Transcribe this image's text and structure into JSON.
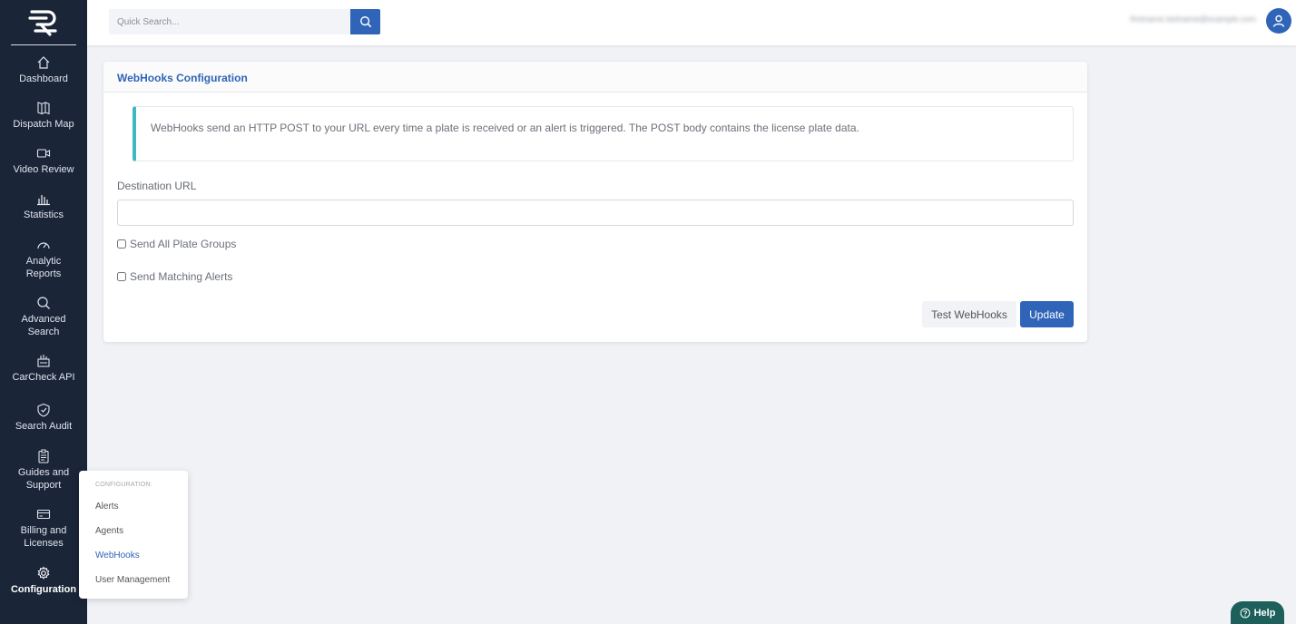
{
  "sidebar": {
    "items": [
      {
        "label": "Dashboard",
        "icon": "home-icon"
      },
      {
        "label": "Dispatch Map",
        "icon": "map-icon"
      },
      {
        "label": "Video Review",
        "icon": "video-icon"
      },
      {
        "label": "Statistics",
        "icon": "bar-chart-icon"
      },
      {
        "label": "Analytic\nReports",
        "icon": "gauge-icon"
      },
      {
        "label": "Advanced\nSearch",
        "icon": "search-icon"
      },
      {
        "label": "CarCheck API",
        "icon": "api-icon"
      },
      {
        "label": "Search Audit",
        "icon": "shield-check-icon"
      },
      {
        "label": "Guides and\nSupport",
        "icon": "clipboard-icon"
      },
      {
        "label": "Billing and\nLicenses",
        "icon": "credit-card-icon"
      },
      {
        "label": "Configuration",
        "icon": "gear-icon"
      }
    ]
  },
  "topbar": {
    "search_placeholder": "Quick Search...",
    "user_email": "firstname.lastname@example.com"
  },
  "card": {
    "title": "WebHooks Configuration",
    "info": "WebHooks send an HTTP POST to your URL every time a plate is received or an alert is triggered. The POST body contains the license plate data.",
    "url_label": "Destination URL",
    "url_value": "",
    "check_all_groups": "Send All Plate Groups",
    "check_matching_alerts": "Send Matching Alerts",
    "test_button": "Test WebHooks",
    "update_button": "Update"
  },
  "config_menu": {
    "header": "CONFIGURATION:",
    "items": [
      "Alerts",
      "Agents",
      "WebHooks",
      "User Management"
    ],
    "active": "WebHooks"
  },
  "help": {
    "label": "Help"
  },
  "colors": {
    "sidebar_bg": "#1b2538",
    "primary": "#2f64b8",
    "callout_accent": "#3fb8c2",
    "help_bg": "#1d5f5a"
  }
}
